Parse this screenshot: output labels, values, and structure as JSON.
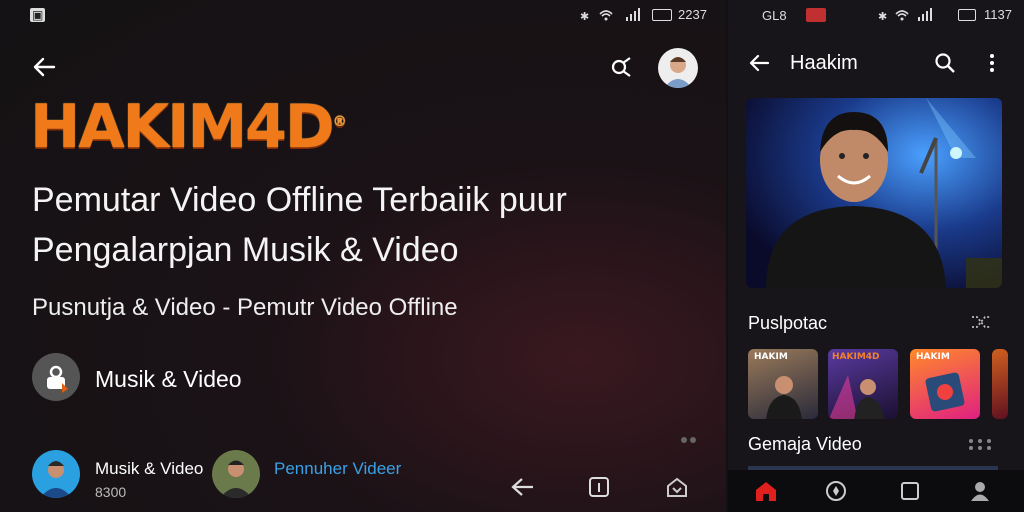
{
  "left": {
    "status": {
      "notif": "▣",
      "time": "2237"
    },
    "brand": "HAKIM4D",
    "brand_mark": "®",
    "title_line1": "Pemutar Video Offline Terbaiik puur",
    "title_line2": "Pengalarpjan Musik & Video",
    "subtitle": "Pusnutja & Video - Pemutr Video Offline",
    "channel_name": "Musik & Video",
    "sub_item1_title": "Musik & Video",
    "sub_item1_meta": "8300",
    "sub_item2_title": "Pennuher Videer"
  },
  "right": {
    "status": {
      "left1": "GL8",
      "time": "1137"
    },
    "header_title": "Haakim",
    "section1_title": "Puslpotac",
    "section2_title": "Gemaja Video",
    "thumb_captions": [
      "HAKIM",
      "HAKIM4D",
      "HAKIM"
    ]
  },
  "colors": {
    "brand": "#f07a1a",
    "link": "#3aa0e8",
    "accent_red": "#e0201c"
  }
}
